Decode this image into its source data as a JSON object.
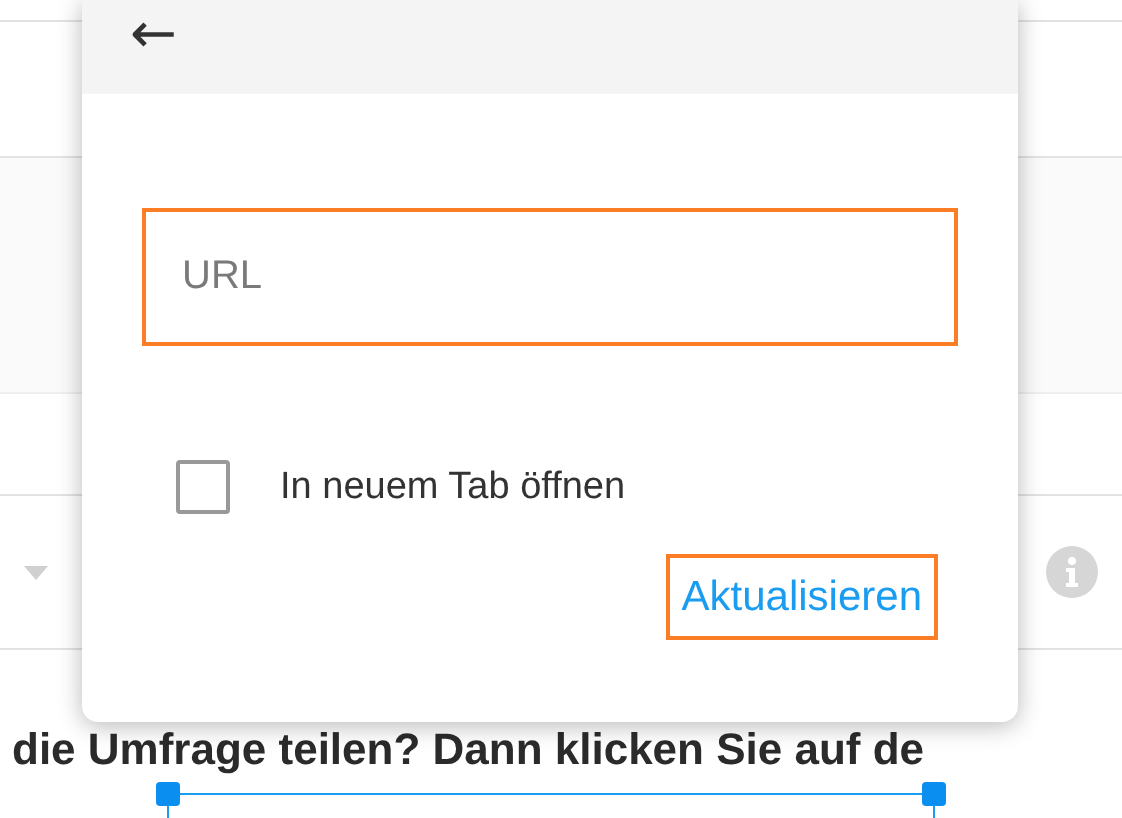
{
  "background": {
    "sentence": "die Umfrage teilen? Dann klicken Sie auf de"
  },
  "dialog": {
    "back_button": {
      "label": "←"
    },
    "url_field": {
      "placeholder": "URL"
    },
    "new_tab": {
      "label": "In neuem Tab öffnen",
      "checked": false
    },
    "submit_button": {
      "label": "Aktualisieren"
    }
  }
}
